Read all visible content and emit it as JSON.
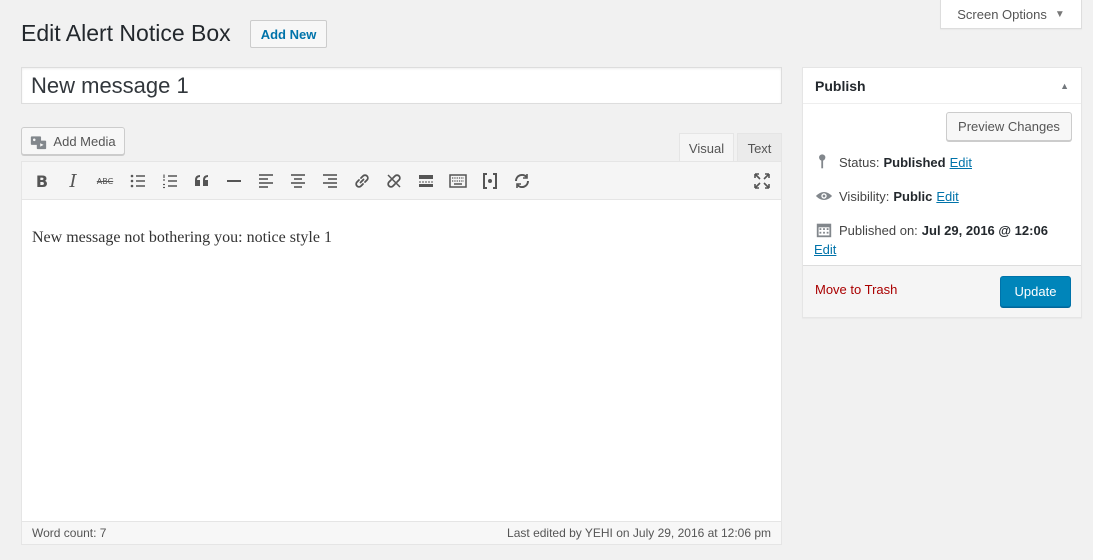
{
  "screen_options": {
    "label": "Screen Options"
  },
  "header": {
    "title": "Edit Alert Notice Box",
    "add_new_label": "Add New"
  },
  "post": {
    "title_value": "New message 1"
  },
  "editor": {
    "add_media_label": "Add Media",
    "tabs": [
      {
        "label": "Visual",
        "active": true
      },
      {
        "label": "Text",
        "active": false
      }
    ],
    "toolbar": {
      "bold_label": "B",
      "italic_label": "I",
      "strikethrough_label": "ABC"
    },
    "content": "New message not bothering you: notice style 1",
    "word_count": "Word count: 7",
    "last_edited": "Last edited by YEHI on July 29, 2016 at 12:06 pm"
  },
  "publish": {
    "title": "Publish",
    "preview_label": "Preview Changes",
    "status_label": "Status:",
    "status_value": "Published",
    "visibility_label": "Visibility:",
    "visibility_value": "Public",
    "published_on_label": "Published on:",
    "published_on_value": "Jul 29, 2016 @ 12:06",
    "edit_label": "Edit",
    "trash_label": "Move to Trash",
    "update_label": "Update"
  },
  "colors": {
    "primary": "#0085ba",
    "link": "#0073aa",
    "danger": "#a00"
  }
}
